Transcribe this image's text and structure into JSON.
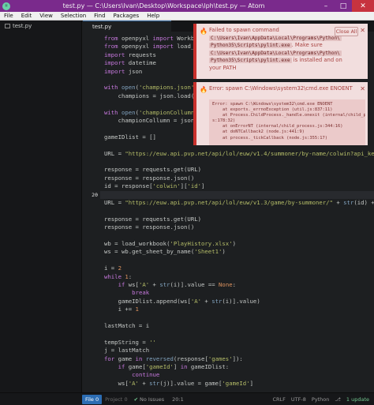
{
  "window": {
    "title": "test.py — C:\\Users\\Ivan\\Desktop\\Workspace\\lph\\test.py — Atom"
  },
  "menu": [
    "File",
    "Edit",
    "View",
    "Selection",
    "Find",
    "Packages",
    "Help"
  ],
  "tree": {
    "file": "test.py"
  },
  "tab": {
    "label": "test.py"
  },
  "gutter": {
    "current_line": "20"
  },
  "code_lines": [
    {
      "parts": [
        [
          "k-kw",
          "from"
        ],
        [
          "k-op",
          " openpyxl "
        ],
        [
          "k-kw",
          "import"
        ],
        [
          "k-op",
          " Workbook"
        ]
      ]
    },
    {
      "parts": [
        [
          "k-kw",
          "from"
        ],
        [
          "k-op",
          " openpyxl "
        ],
        [
          "k-kw",
          "import"
        ],
        [
          "k-op",
          " load_wor"
        ]
      ]
    },
    {
      "parts": [
        [
          "k-kw",
          "import"
        ],
        [
          "k-op",
          " requests"
        ]
      ]
    },
    {
      "parts": [
        [
          "k-kw",
          "import"
        ],
        [
          "k-op",
          " datetime"
        ]
      ]
    },
    {
      "parts": [
        [
          "k-kw",
          "import"
        ],
        [
          "k-op",
          " json"
        ]
      ]
    },
    {
      "parts": []
    },
    {
      "parts": [
        [
          "k-kw",
          "with"
        ],
        [
          "k-op",
          " "
        ],
        [
          "k-fn",
          "open"
        ],
        [
          "k-op",
          "("
        ],
        [
          "k-str",
          "'champions.json'"
        ],
        [
          "k-op",
          ", "
        ]
      ]
    },
    {
      "parts": [
        [
          "k-op",
          "    champions = json.load(fil"
        ]
      ]
    },
    {
      "parts": []
    },
    {
      "parts": [
        [
          "k-kw",
          "with"
        ],
        [
          "k-op",
          " "
        ],
        [
          "k-fn",
          "open"
        ],
        [
          "k-op",
          "("
        ],
        [
          "k-str",
          "'championCollumn.js"
        ]
      ]
    },
    {
      "parts": [
        [
          "k-op",
          "    championCollumn = json.lo"
        ]
      ]
    },
    {
      "parts": []
    },
    {
      "parts": [
        [
          "k-op",
          "gameIDlist = []"
        ]
      ]
    },
    {
      "parts": []
    },
    {
      "parts": [
        [
          "k-op",
          "URL = "
        ],
        [
          "k-str",
          "\"https://euw.api.pvp.net/api/lol/euw/v1.4/summoner/by-name/colwin?api_ke"
        ]
      ]
    },
    {
      "parts": []
    },
    {
      "parts": [
        [
          "k-op",
          "response = requests.get(URL)"
        ]
      ]
    },
    {
      "parts": [
        [
          "k-op",
          "response = response.json()"
        ]
      ]
    },
    {
      "parts": [
        [
          "k-op",
          "id = response["
        ],
        [
          "k-str",
          "'colwin'"
        ],
        [
          "k-op",
          "]["
        ],
        [
          "k-str",
          "'id'"
        ],
        [
          "k-op",
          "]"
        ]
      ]
    },
    {
      "parts": []
    },
    {
      "parts": [
        [
          "k-op",
          "URL = "
        ],
        [
          "k-str",
          "\"https://euw.api.pvp.net/api/lol/euw/v1.3/game/by-summoner/\""
        ],
        [
          "k-op",
          " + "
        ],
        [
          "k-fn",
          "str"
        ],
        [
          "k-op",
          "(id) +"
        ]
      ]
    },
    {
      "parts": []
    },
    {
      "parts": [
        [
          "k-op",
          "response = requests.get(URL)"
        ]
      ]
    },
    {
      "parts": [
        [
          "k-op",
          "response = response.json()"
        ]
      ]
    },
    {
      "parts": []
    },
    {
      "parts": [
        [
          "k-op",
          "wb = load_workbook("
        ],
        [
          "k-str",
          "'PlayHistory.xlsx'"
        ],
        [
          "k-op",
          ")"
        ]
      ]
    },
    {
      "parts": [
        [
          "k-op",
          "ws = wb.get_sheet_by_name("
        ],
        [
          "k-str",
          "'Sheet1'"
        ],
        [
          "k-op",
          ")"
        ]
      ]
    },
    {
      "parts": []
    },
    {
      "parts": [
        [
          "k-op",
          "i = "
        ],
        [
          "k-num",
          "2"
        ]
      ]
    },
    {
      "parts": [
        [
          "k-kw",
          "while"
        ],
        [
          "k-op",
          " "
        ],
        [
          "k-num",
          "1"
        ],
        [
          "k-op",
          ":"
        ]
      ]
    },
    {
      "parts": [
        [
          "k-op",
          "    "
        ],
        [
          "k-kw",
          "if"
        ],
        [
          "k-op",
          " ws["
        ],
        [
          "k-str",
          "'A'"
        ],
        [
          "k-op",
          " + "
        ],
        [
          "k-fn",
          "str"
        ],
        [
          "k-op",
          "(i)].value == "
        ],
        [
          "k-num",
          "None"
        ],
        [
          "k-op",
          ":"
        ]
      ]
    },
    {
      "parts": [
        [
          "k-op",
          "        "
        ],
        [
          "k-kw",
          "break"
        ]
      ]
    },
    {
      "parts": [
        [
          "k-op",
          "    gameIDlist.append(ws["
        ],
        [
          "k-str",
          "'A'"
        ],
        [
          "k-op",
          " + "
        ],
        [
          "k-fn",
          "str"
        ],
        [
          "k-op",
          "(i)].value)"
        ]
      ]
    },
    {
      "parts": [
        [
          "k-op",
          "    i += "
        ],
        [
          "k-num",
          "1"
        ]
      ]
    },
    {
      "parts": []
    },
    {
      "parts": [
        [
          "k-op",
          "lastMatch = i"
        ]
      ]
    },
    {
      "parts": []
    },
    {
      "parts": [
        [
          "k-op",
          "tempString = "
        ],
        [
          "k-str",
          "''"
        ]
      ]
    },
    {
      "parts": [
        [
          "k-op",
          "j = lastMatch"
        ]
      ]
    },
    {
      "parts": [
        [
          "k-kw",
          "for"
        ],
        [
          "k-op",
          " game "
        ],
        [
          "k-kw",
          "in"
        ],
        [
          "k-op",
          " "
        ],
        [
          "k-fn",
          "reversed"
        ],
        [
          "k-op",
          "(response["
        ],
        [
          "k-str",
          "'games'"
        ],
        [
          "k-op",
          "]):"
        ]
      ]
    },
    {
      "parts": [
        [
          "k-op",
          "    "
        ],
        [
          "k-kw",
          "if"
        ],
        [
          "k-op",
          " game["
        ],
        [
          "k-str",
          "'gameId'"
        ],
        [
          "k-op",
          "] "
        ],
        [
          "k-kw",
          "in"
        ],
        [
          "k-op",
          " gameIDlist:"
        ]
      ]
    },
    {
      "parts": [
        [
          "k-op",
          "        "
        ],
        [
          "k-kw",
          "continue"
        ]
      ]
    },
    {
      "parts": [
        [
          "k-op",
          "    ws["
        ],
        [
          "k-str",
          "'A'"
        ],
        [
          "k-op",
          " + "
        ],
        [
          "k-fn",
          "str"
        ],
        [
          "k-op",
          "(j)].value = game["
        ],
        [
          "k-str",
          "'gameId'"
        ],
        [
          "k-op",
          "]"
        ]
      ]
    }
  ],
  "notifications": {
    "spawn_cmd": {
      "line1": "Failed to spawn command",
      "path1": "C:\\Users\\Ivan\\AppData\\Local\\Programs\\Python\\",
      "path2": "Python35\\Scripts\\pylint.exe",
      "line2_suffix": ". Make sure",
      "path3": "C:\\Users\\Ivan\\AppData\\Local\\Programs\\Python\\",
      "path4": "Python35\\Scripts\\pylint.exe",
      "line3_suffix": " is installed and on",
      "line4": "your PATH",
      "close_all": "Close All"
    },
    "enoent": {
      "title": "Error: spawn C:\\Windows\\system32\\cmd.exe ENOENT",
      "trace": "Error: spawn C:\\Windows\\system32\\cmd.exe ENOENT\n    at exports._errnoException (util.js:837:11)\n    at Process.ChildProcess._handle.onexit (internal/child_process.j\ns:178:32)\n    at onErrorNT (internal/child_process.js:344:16)\n    at doNTCallback2 (node.js:441:9)\n    at process._tickCallback (node.js:355:17)"
    }
  },
  "status": {
    "file": "File",
    "file_count": "0",
    "project": "Project",
    "project_count": "0",
    "issues": "No Issues",
    "position": "20:1",
    "line_ending": "CRLF",
    "encoding": "UTF-8",
    "grammar": "Python",
    "updates": "1 update"
  },
  "colors": {
    "titlebar": "#7a2a8c",
    "error_bg": "#f2dede",
    "error_border": "#c9302c",
    "status_file": "#2c6db3"
  }
}
